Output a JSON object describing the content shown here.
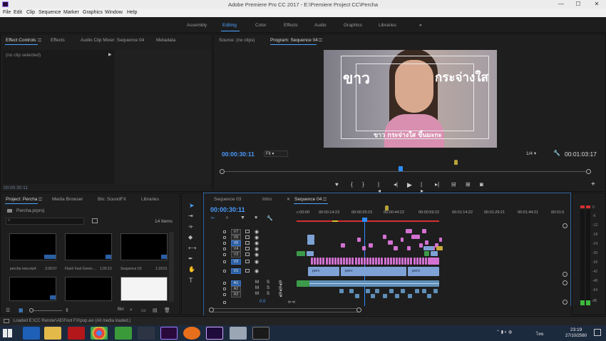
{
  "titlebar": {
    "title": "Adobe Premiere Pro CC 2017 - E:\\Premiere Project CC\\Percha",
    "minimize": "—",
    "maximize": "☐",
    "close": "✕"
  },
  "menu": [
    "File",
    "Edit",
    "Clip",
    "Sequence",
    "Marker",
    "Graphics",
    "Window",
    "Help"
  ],
  "workspaces": [
    "Assembly",
    "Editing",
    "Color",
    "Effects",
    "Audio",
    "Graphics",
    "Libraries"
  ],
  "workspace_more": "»",
  "effect_controls": {
    "tabs": [
      "Effect Controls",
      "Effects",
      "Audio Clip Mixer: Sequence 04",
      "Metadata"
    ],
    "empty": "(no clip selected)",
    "timecode": "00:00:30:11"
  },
  "program": {
    "source_tab": "Source: (no clips)",
    "program_tab": "Program: Sequence 04",
    "overlay_left": "ขาว",
    "overlay_right": "กระจ่างใส",
    "subtitle": "ขาว กระจ่างใส ขึ้นมะกะ",
    "timecode": "00:00:30:11",
    "fit": "Fit",
    "quality": "1/4",
    "duration": "00:01:03:17"
  },
  "project": {
    "tabs": [
      "Project: Percha",
      "Media Browser",
      "Bin: SoundFX",
      "Libraries"
    ],
    "path": "Percha.prproj",
    "count": "14 Items",
    "items": [
      {
        "name": "percha new.mp4",
        "dur": "3:28:07"
      },
      {
        "name": "Flash Fast Green ...",
        "dur": "1:05:10"
      },
      {
        "name": "Sequence 03",
        "dur": "1:18:01"
      },
      {
        "name": "",
        "dur": ""
      },
      {
        "name": "",
        "dur": ""
      },
      {
        "name": "",
        "dur": ""
      }
    ],
    "bin_label": "Bin"
  },
  "timeline": {
    "tabs": [
      "Sequence 03",
      "Intro",
      "Sequence 04"
    ],
    "timecode": "00:00:30:11",
    "ruler": [
      "c:00:00",
      "00:00:14:23",
      "00:00:29:23",
      "00:00:44:22",
      "00:00:59:22",
      "00:01:14:22",
      "00:01:29:21",
      "00:01:44:21",
      "00:01:5"
    ],
    "video_tracks": [
      "V7",
      "V6",
      "V5",
      "V4",
      "V3",
      "V2",
      "V1"
    ],
    "audio_tracks": [
      "A1",
      "A2",
      "A3"
    ],
    "master": "0.0",
    "clip_labels": [
      "perc",
      "perc",
      "pero"
    ],
    "mute": "M",
    "solo": "S"
  },
  "meter": [
    "0",
    "-6",
    "-12",
    "-18",
    "-24",
    "-30",
    "-36",
    "-42",
    "-48",
    "-54",
    "dB"
  ],
  "status": "Loaded E:\\CC Render\\AE\\Foot FX\\pop.avi (All media loaded.)",
  "tray": {
    "time": "23:19",
    "date": "27/10/2560",
    "lang": "ไทย"
  },
  "colors": {
    "accent": "#4aa3ff",
    "clip_magenta": "#d371d2",
    "clip_blue": "#7ea2d6",
    "clip_audio": "#5f8fb8",
    "clip_green": "#3c9a4a",
    "taskbar": "#1c2a3e"
  }
}
